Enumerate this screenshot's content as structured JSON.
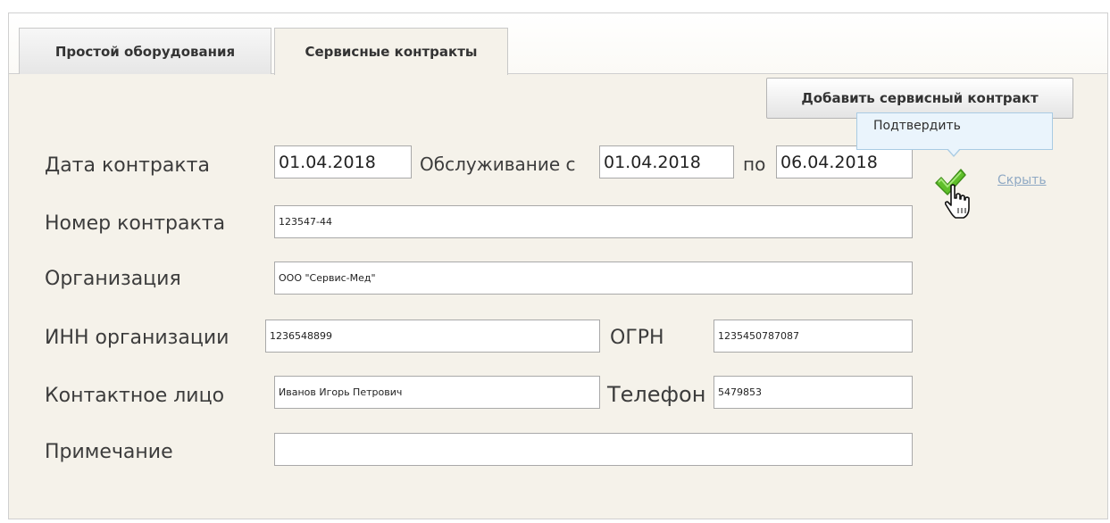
{
  "tabs": [
    {
      "label": "Простой оборудования",
      "active": false
    },
    {
      "label": "Сервисные контракты",
      "active": true
    }
  ],
  "toolbar": {
    "add_label": "Добавить сервисный контракт"
  },
  "tooltip": {
    "text": "Подтвердить"
  },
  "actions": {
    "confirm_icon": "checkmark-icon",
    "hide_label": "Скрыть"
  },
  "form": {
    "contract_date": {
      "label": "Дата контракта",
      "value": "01.04.2018"
    },
    "service_from": {
      "label": "Обслуживание с",
      "value": "01.04.2018"
    },
    "service_to": {
      "label": "по",
      "value": "06.04.2018"
    },
    "contract_number": {
      "label": "Номер контракта",
      "value": "123547-44"
    },
    "organization": {
      "label": "Организация",
      "value": "ООО \"Сервис-Мед\""
    },
    "inn": {
      "label": "ИНН организации",
      "value": "1236548899"
    },
    "ogrn": {
      "label": "ОГРН",
      "value": "1235450787087"
    },
    "contact_person": {
      "label": "Контактное лицо",
      "value": "Иванов Игорь Петрович"
    },
    "phone": {
      "label": "Телефон",
      "value": "5479853"
    },
    "note": {
      "label": "Примечание",
      "value": ""
    }
  },
  "colors": {
    "panel_bg": "#f5f2ea",
    "tooltip_bg": "#eaf4fc",
    "link": "#8fa9c4",
    "check": "#5fbf2a"
  }
}
